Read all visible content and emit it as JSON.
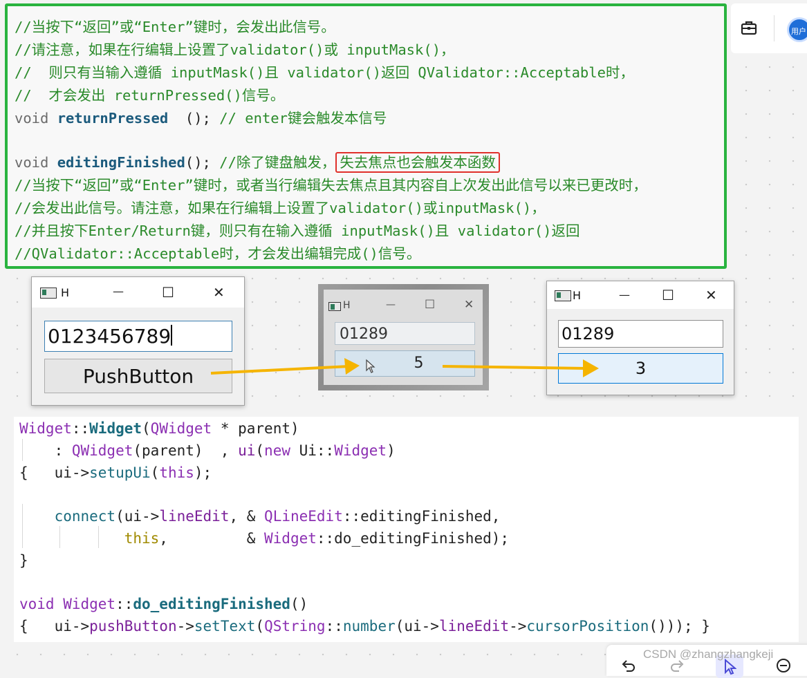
{
  "top_code": {
    "lines": [
      "//当按下“返回”或“Enter”键时，会发出此信号。",
      "//请注意，如果在行编辑上设置了validator()或 inputMask()，",
      "//  则只有当输入遵循 inputMask()且 validator()返回 QValidator::Acceptable时，",
      "//  才会发出 returnPressed()信号。"
    ],
    "rp_void": "void ",
    "rp_name": "returnPressed",
    "rp_tail": "  (); ",
    "rp_comment": "// enter键会触发本信号",
    "ef_void": "void ",
    "ef_name": "editingFinished",
    "ef_tail": "(); ",
    "ef_comment": "//除了键盘触发，",
    "ef_highlight": "失去焦点也会触发本函数",
    "lines2": [
      "//当按下“返回”或“Enter”键时，或者当行编辑失去焦点且其内容自上次发出此信号以来已更改时，",
      "//会发出此信号。请注意，如果在行编辑上设置了validator()或inputMask()，",
      "//并且按下Enter/Return键，则只有在输入遵循 inputMask()且 validator()返回",
      "//QValidator::Acceptable时，才会发出编辑完成()信号。"
    ]
  },
  "toolbar": {
    "avatar_text": "用户",
    "briefcase_icon": "briefcase-icon"
  },
  "windows": [
    {
      "title": "H",
      "minimize": "—",
      "maximize": "☐",
      "close": "✕",
      "edit_value": "0123456789",
      "button_label": "PushButton"
    },
    {
      "title": "H",
      "minimize": "—",
      "maximize": "☐",
      "close": "✕",
      "edit_value": "01289",
      "button_label": "5"
    },
    {
      "title": "H",
      "minimize": "—",
      "maximize": "☐",
      "close": "✕",
      "edit_value": "01289",
      "button_label": "3"
    }
  ],
  "arrow_color": "#f5b400",
  "curve_color": "#e07b1a",
  "bottom_code": {
    "l1a": "Widget",
    "l1b": "::",
    "l1c": "Widget",
    "l1d": "(",
    "l1e": "QWidget",
    "l1f": " * parent)",
    "l2a": "    : ",
    "l2b": "QWidget",
    "l2c": "(parent)  , ",
    "l2d": "ui",
    "l2e": "(",
    "l2f": "new",
    "l2g": " Ui::",
    "l2h": "Widget",
    "l2i": ")",
    "l3a": "{   ui->",
    "l3b": "setupUi",
    "l3c": "(",
    "l3d": "this",
    "l3e": ");",
    "l5a": "    ",
    "l5b": "connect",
    "l5c": "(ui->",
    "l5d": "lineEdit",
    "l5e": ", & ",
    "l5f": "QLineEdit",
    "l5g": "::editingFinished,",
    "l6a": "            ",
    "l6b": "this",
    "l6c": ",         & ",
    "l6d": "Widget",
    "l6e": "::do_editingFinished);",
    "l7": "}",
    "l9a": "void ",
    "l9b": "Widget",
    "l9c": "::",
    "l9d": "do_editingFinished",
    "l9e": "()",
    "l10a": "{   ui->",
    "l10b": "pushButton",
    "l10c": "->",
    "l10d": "setText",
    "l10e": "(",
    "l10f": "QString",
    "l10g": "::",
    "l10h": "number",
    "l10i": "(ui->",
    "l10j": "lineEdit",
    "l10k": "->",
    "l10l": "cursorPosition",
    "l10m": "())); }"
  },
  "watermark": "CSDN @zhangzhangkeji"
}
